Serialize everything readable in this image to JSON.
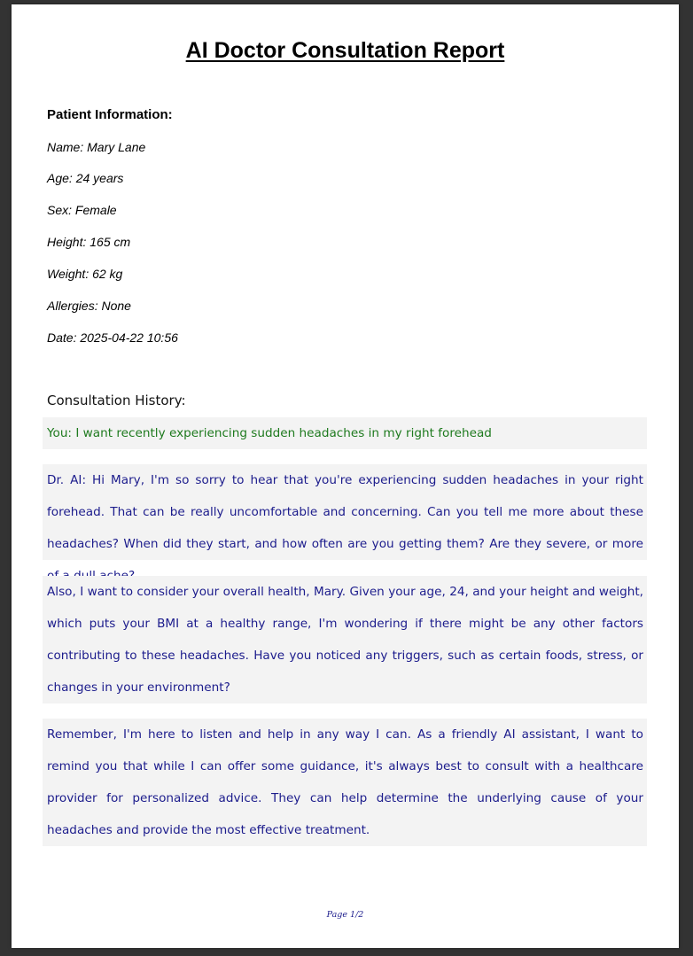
{
  "report": {
    "title": "AI Doctor Consultation Report",
    "patient_heading": "Patient Information:",
    "patient": {
      "name": "Name: Mary Lane",
      "age": "Age: 24 years",
      "sex": "Sex: Female",
      "height": "Height: 165 cm",
      "weight": "Weight: 62 kg",
      "allergies": "Allergies: None",
      "date": "Date: 2025-04-22 10:56"
    },
    "history_heading": "Consultation History:",
    "messages": [
      "You: I want recently experiencing sudden headaches in my right forehead",
      "Dr. AI: Hi Mary, I'm so sorry to hear that you're experiencing sudden headaches in your right forehead. That can be really uncomfortable and concerning. Can you tell me more about these headaches? When did they start, and how often are you getting them? Are they severe, or more of a dull ache?",
      "Also, I want to consider your overall health, Mary. Given your age, 24, and your height and weight, which puts your BMI at a healthy range, I'm wondering if there might be any other factors contributing to these headaches. Have you noticed any triggers, such as certain foods, stress, or changes in your environment?",
      "Remember, I'm here to listen and help in any way I can. As a friendly AI assistant, I want to remind you that while I can offer some guidance, it's always best to consult with a healthcare provider for personalized advice. They can help determine the underlying cause of your headaches and provide the most effective treatment."
    ],
    "footer": "Page 1/2"
  }
}
